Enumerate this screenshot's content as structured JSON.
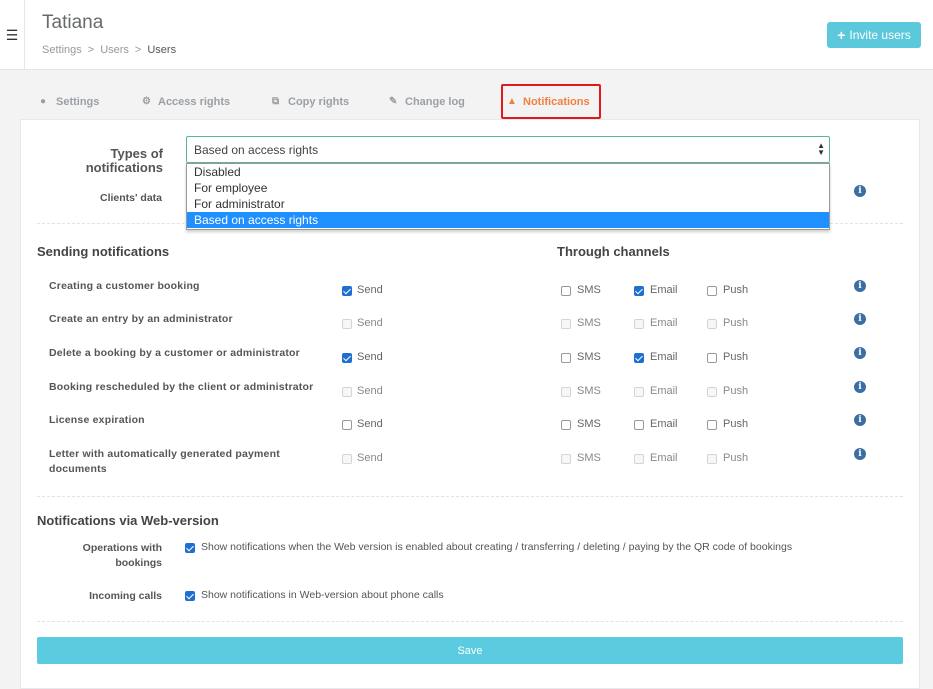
{
  "header": {
    "title": "Tatiana",
    "breadcrumb": [
      "Settings",
      ">",
      "Users",
      ">",
      "Users"
    ],
    "invite_label": "Invite users"
  },
  "tabs": [
    {
      "label": "Settings",
      "icon": "user-icon"
    },
    {
      "label": "Access rights",
      "icon": "gears-icon"
    },
    {
      "label": "Copy rights",
      "icon": "copy-icon"
    },
    {
      "label": "Change log",
      "icon": "edit-icon"
    },
    {
      "label": "Notifications",
      "icon": "bell-icon",
      "active": true
    }
  ],
  "types": {
    "label": "Types of notifications",
    "selected": "Based on access rights",
    "options": [
      "Disabled",
      "For employee",
      "For administrator",
      "Based on access rights"
    ],
    "clients_label": "Clients' data"
  },
  "sending": {
    "title": "Sending notifications",
    "channels_title": "Through channels",
    "send_label": "Send",
    "sms_label": "SMS",
    "email_label": "Email",
    "push_label": "Push",
    "rows": [
      {
        "label": "Creating a customer booking",
        "send": true,
        "enabled": true,
        "sms": false,
        "email": true,
        "push": false
      },
      {
        "label": "Create an entry by an administrator",
        "send": false,
        "enabled": false,
        "sms": false,
        "email": false,
        "push": false
      },
      {
        "label": "Delete a booking by a customer or administrator",
        "send": true,
        "enabled": true,
        "sms": false,
        "email": true,
        "push": false
      },
      {
        "label": "Booking rescheduled by the client or administrator",
        "send": false,
        "enabled": false,
        "sms": false,
        "email": false,
        "push": false
      },
      {
        "label": "License expiration",
        "send": false,
        "enabled": true,
        "sms": false,
        "email": false,
        "push": false
      },
      {
        "label": "Letter with automatically generated payment documents",
        "send": false,
        "enabled": false,
        "sms": false,
        "email": false,
        "push": false
      }
    ]
  },
  "web": {
    "title": "Notifications via Web-version",
    "ops_label": "Operations with bookings",
    "ops_text": "Show notifications when the Web version is enabled about creating / transferring / deleting / paying by the QR code of bookings",
    "calls_label": "Incoming calls",
    "calls_text": "Show notifications in Web-version about phone calls"
  },
  "save_label": "Save",
  "colors": {
    "accent": "#5bc8dc",
    "active_tab": "#f0803c",
    "checkbox": "#1f6fd1",
    "highlight": "#e01919"
  }
}
